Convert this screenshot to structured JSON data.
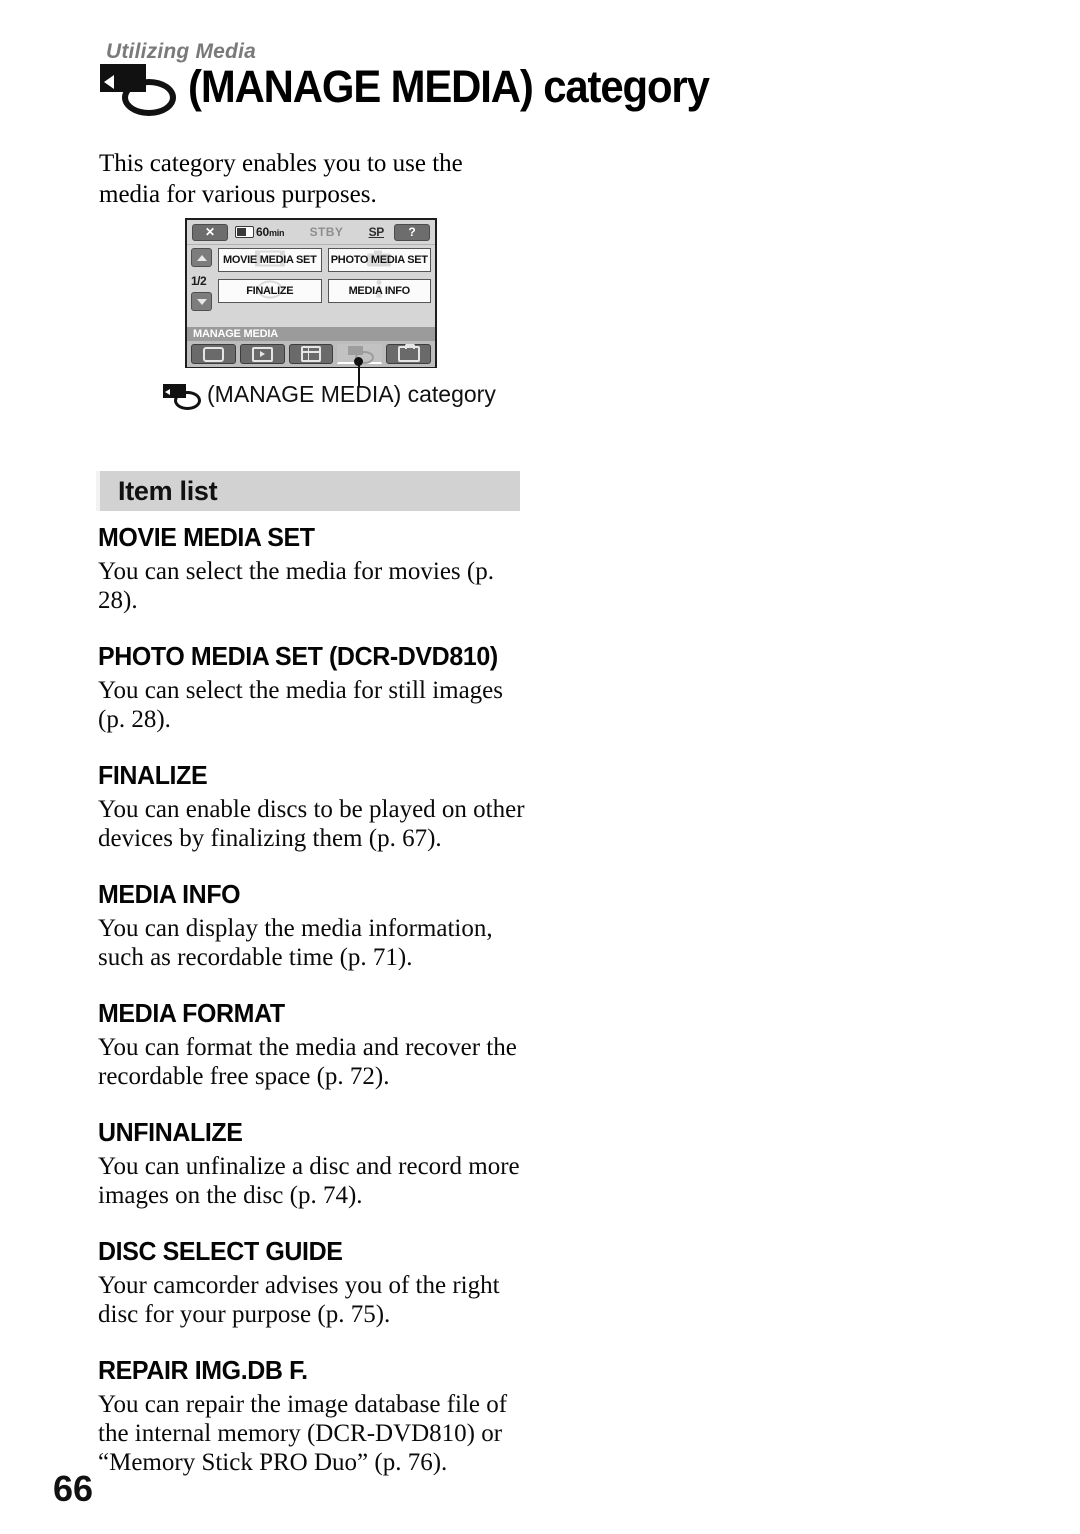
{
  "header": {
    "kicker": "Utilizing Media",
    "title": "(MANAGE MEDIA) category",
    "icon": "manage-media-icon"
  },
  "intro": "This category enables you to use the media for various purposes.",
  "figure": {
    "caption": "(MANAGE MEDIA) category",
    "caption_icon": "manage-media-icon",
    "lcd": {
      "status": {
        "close_label": "✕",
        "battery_icon": "battery-icon",
        "battery_time": "60",
        "battery_unit": "min",
        "mode": "STBY",
        "quality": "SP",
        "help_label": "?"
      },
      "nav": {
        "up_icon": "chevron-up-icon",
        "page_indicator": "1/2",
        "down_icon": "chevron-down-icon"
      },
      "items": [
        {
          "label": "MOVIE MEDIA SET",
          "watermark": "film-icon"
        },
        {
          "label": "PHOTO MEDIA SET",
          "watermark": "camera-icon"
        },
        {
          "label": "FINALIZE",
          "watermark": "disc-icon"
        },
        {
          "label": "MEDIA INFO",
          "watermark": "info-icon"
        }
      ],
      "category_label": "MANAGE MEDIA",
      "tabs": [
        {
          "icon": "camcorder-tab-icon",
          "selected": false
        },
        {
          "icon": "playback-tab-icon",
          "selected": false
        },
        {
          "icon": "menu-grid-tab-icon",
          "selected": false
        },
        {
          "icon": "manage-media-tab-icon",
          "selected": true
        },
        {
          "icon": "settings-toolbox-tab-icon",
          "selected": false
        }
      ]
    }
  },
  "section": {
    "band_title": "Item list"
  },
  "items": [
    {
      "heading": "MOVIE MEDIA SET",
      "body": "You can select the media for movies (p. 28)."
    },
    {
      "heading": "PHOTO MEDIA SET (DCR-DVD810)",
      "body": "You can select the media for still images (p. 28)."
    },
    {
      "heading": "FINALIZE",
      "body": "You can enable discs to be played on other devices by finalizing them (p. 67)."
    },
    {
      "heading": "MEDIA INFO",
      "body": "You can display the media information, such as recordable time (p. 71)."
    },
    {
      "heading": "MEDIA FORMAT",
      "body": "You can format the media and recover the recordable free space (p. 72)."
    },
    {
      "heading": "UNFINALIZE",
      "body": "You can unfinalize a disc and record more images on the disc (p. 74)."
    },
    {
      "heading": "DISC SELECT GUIDE",
      "body": "Your camcorder advises you of the right disc for your purpose (p. 75)."
    },
    {
      "heading": "REPAIR IMG.DB F.",
      "body": "You can repair the image database file of the internal memory (DCR-DVD810) or “Memory Stick PRO Duo” (p. 76)."
    }
  ],
  "page_number": "66"
}
